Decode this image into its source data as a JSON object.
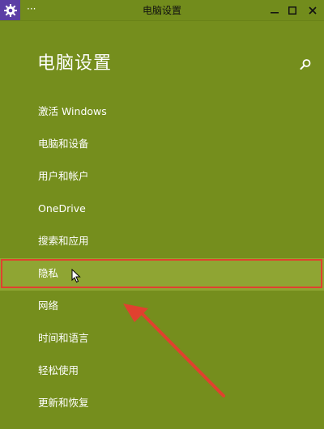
{
  "window": {
    "title": "电脑设置",
    "system_menu_glyph": "···",
    "icons": {
      "app": "gear-icon",
      "minimize": "minimize-icon",
      "maximize": "maximize-icon",
      "close": "close-icon",
      "search": "search-icon"
    }
  },
  "page": {
    "title": "电脑设置"
  },
  "nav": {
    "items": [
      {
        "label": "激活 Windows"
      },
      {
        "label": "电脑和设备"
      },
      {
        "label": "用户和帐户"
      },
      {
        "label": "OneDrive"
      },
      {
        "label": "搜索和应用"
      },
      {
        "label": "隐私"
      },
      {
        "label": "网络"
      },
      {
        "label": "时间和语言"
      },
      {
        "label": "轻松使用"
      },
      {
        "label": "更新和恢复"
      }
    ],
    "selected_index": 5
  },
  "colors": {
    "background": "#758e1d",
    "hover_row": "#8fa533",
    "annotation_red": "#e0412f",
    "title_bar_icon": "#5b3ea5"
  }
}
